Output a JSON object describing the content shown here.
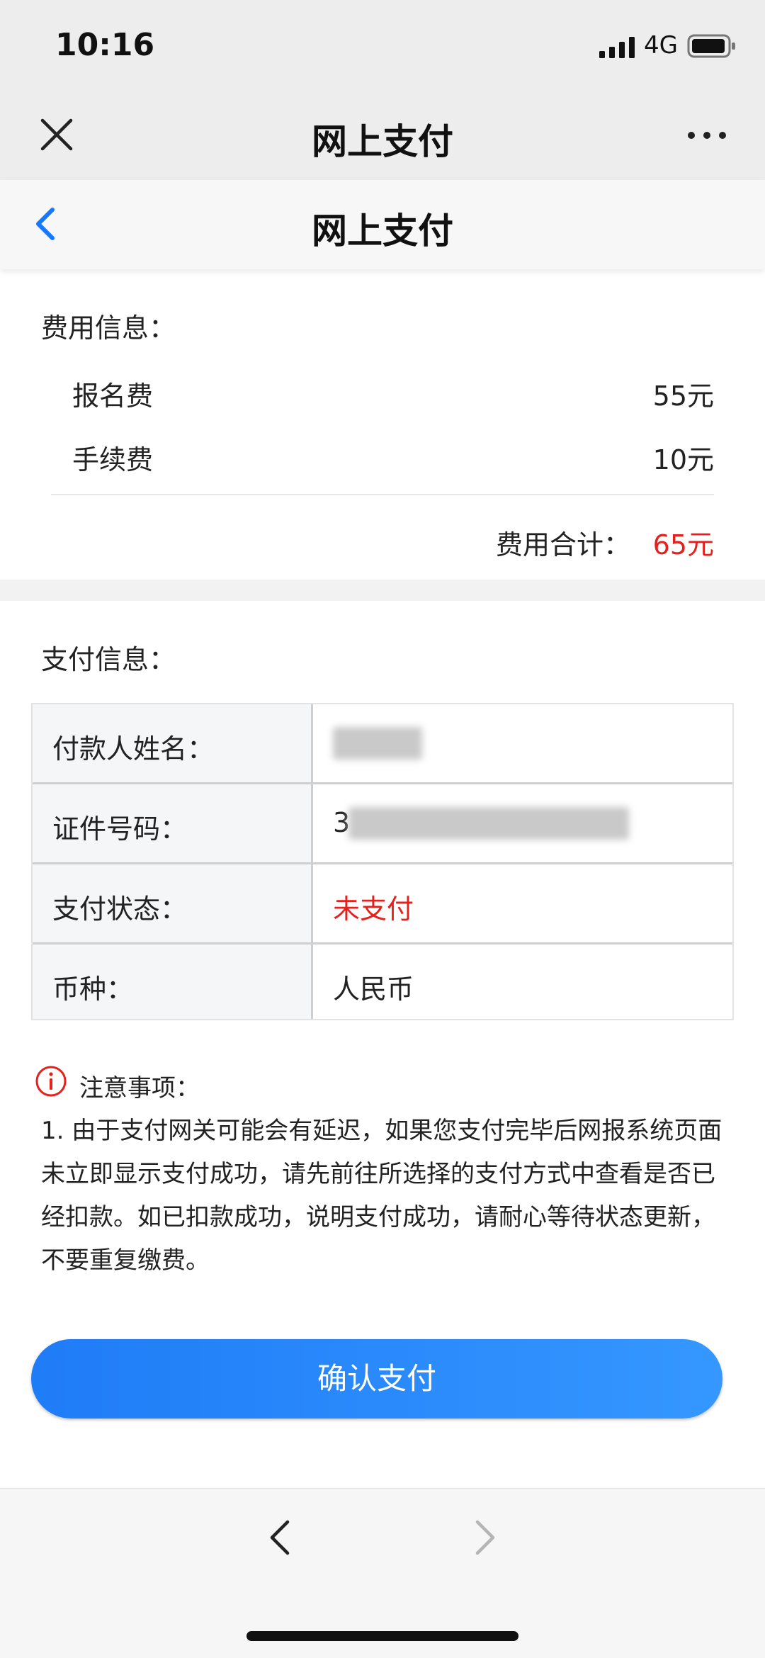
{
  "status_bar": {
    "time": "10:16",
    "network": "4G"
  },
  "nav_bar": {
    "title": "网上支付"
  },
  "page_header": {
    "title": "网上支付"
  },
  "fee_section": {
    "label": "费用信息：",
    "items": [
      {
        "label": "报名费",
        "value": "55元"
      },
      {
        "label": "手续费",
        "value": "10元"
      }
    ],
    "total_label": "费用合计：",
    "total_value": "65元"
  },
  "payment_section": {
    "label": "支付信息：",
    "rows": [
      {
        "label": "付款人姓名：",
        "value": ""
      },
      {
        "label": "证件号码：",
        "value": "3"
      },
      {
        "label": "支付状态：",
        "value": "未支付"
      },
      {
        "label": "币种：",
        "value": "人民币"
      }
    ]
  },
  "notice": {
    "title": "注意事项：",
    "text": "1. 由于支付网关可能会有延迟，如果您支付完毕后网报系统页面未立即显示支付成功，请先前往所选择的支付方式中查看是否已经扣款。如已扣款成功，说明支付成功，请耐心等待状态更新，不要重复缴费。"
  },
  "confirm_button": {
    "label": "确认支付"
  },
  "colors": {
    "accent": "#1f7cf7",
    "alert_red": "#e5211e",
    "nav_bg": "#ededed"
  },
  "icons": [
    "close-icon",
    "more-icon",
    "back-icon",
    "info-icon",
    "nav-back-icon",
    "nav-forward-icon",
    "signal-icon",
    "battery-icon"
  ]
}
